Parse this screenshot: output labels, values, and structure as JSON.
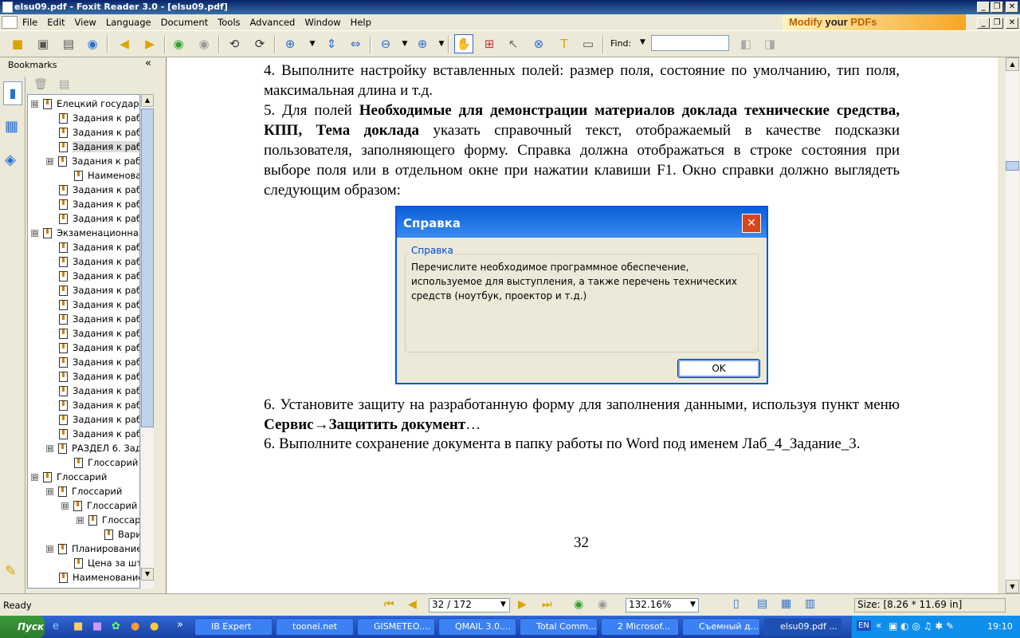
{
  "window": {
    "title": "elsu09.pdf - Foxit Reader 3.0 - [elsu09.pdf]",
    "minimize": "_",
    "restore": "❐",
    "close": "✕"
  },
  "menu": [
    "File",
    "Edit",
    "View",
    "Language",
    "Document",
    "Tools",
    "Advanced",
    "Window",
    "Help"
  ],
  "ad": {
    "part1": "Modify ",
    "part2": "your ",
    "part3": "PDFs"
  },
  "find": {
    "label": "Find:",
    "value": ""
  },
  "bookmarks": {
    "title": "Bookmarks",
    "collapse": "«",
    "items": [
      {
        "label": "Елецкий государс",
        "level": 0,
        "expander": "⊟"
      },
      {
        "label": "Задания к раб",
        "level": 1
      },
      {
        "label": "Задания к раб",
        "level": 1
      },
      {
        "label": "Задания к раб",
        "level": 1,
        "selected": true
      },
      {
        "label": "Задания к раб",
        "level": 1,
        "expander": "⊟"
      },
      {
        "label": "Наименова",
        "level": 2
      },
      {
        "label": "Задания к раб",
        "level": 1
      },
      {
        "label": "Задания к раб",
        "level": 1
      },
      {
        "label": "Задания к раб",
        "level": 1
      },
      {
        "label": "Экзаменационная",
        "level": 0,
        "expander": "⊟"
      },
      {
        "label": "Задания к раб",
        "level": 1
      },
      {
        "label": "Задания к раб",
        "level": 1
      },
      {
        "label": "Задания к раб",
        "level": 1
      },
      {
        "label": "Задания к раб",
        "level": 1
      },
      {
        "label": "Задания к раб",
        "level": 1
      },
      {
        "label": "Задания к раб",
        "level": 1
      },
      {
        "label": "Задания к раб",
        "level": 1
      },
      {
        "label": "Задания к раб",
        "level": 1
      },
      {
        "label": "Задания к раб",
        "level": 1
      },
      {
        "label": "Задания к раб",
        "level": 1
      },
      {
        "label": "Задания к раб",
        "level": 1
      },
      {
        "label": "Задания к раб",
        "level": 1
      },
      {
        "label": "Задания к раб",
        "level": 1
      },
      {
        "label": "Задания к раб",
        "level": 1
      },
      {
        "label": "РАЗДЕЛ 6. Зад",
        "level": 1,
        "expander": "⊟"
      },
      {
        "label": "Глоссарий",
        "level": 2
      },
      {
        "label": "Глоссарий",
        "level": 0,
        "expander": "⊟"
      },
      {
        "label": "Глоссарий",
        "level": 1,
        "expander": "⊟"
      },
      {
        "label": "Глоссарий",
        "level": 2,
        "expander": "⊟"
      },
      {
        "label": "Глоссар",
        "level": 3,
        "expander": "⊟"
      },
      {
        "label": "Вари",
        "level": 4
      },
      {
        "label": "Планирование",
        "level": 1,
        "expander": "⊟"
      },
      {
        "label": "Цена за шту",
        "level": 2
      },
      {
        "label": "Наименование",
        "level": 1
      }
    ]
  },
  "document": {
    "para4": "4. Выполните настройку вставленных полей: размер поля, состояние по умолчанию, тип поля, максимальная длина и т.д.",
    "para5_a": "5. Для полей ",
    "para5_bold": "Необходимые для демонстрации материалов доклада технические средства, КПП, Тема доклада",
    "para5_b": " указать справочный текст, отображаемый в качестве подсказки пользователя, заполняющего форму. Справка должна отображаться в строке состояния при выборе поля или в отдельном окне при нажатии клавиши F1. Окно справки должно выглядеть следующим образом:",
    "para6a_a": "6. Установите защиту на разработанную форму для заполнения данными, используя пункт меню ",
    "para6a_bold": "Сервис→Защитить документ",
    "para6a_b": "…",
    "para6b": "6. Выполните сохранение документа в папку работы по Word под именем Лаб_4_Задание_3.",
    "page_number": "32"
  },
  "dialog": {
    "title": "Справка",
    "close": "✕",
    "group_label": "Справка",
    "text": "Перечислите необходимое программное обеспечение, используемое для выступления, а также перечень технических средств (ноутбук, проектор и т.д.)",
    "ok": "OK"
  },
  "status": {
    "ready": "Ready",
    "page": "32 / 172",
    "zoom": "132.16%",
    "size": "Size: [8.26 * 11.69 in]"
  },
  "taskbar": {
    "start": "Пуск",
    "tasks": [
      "IB Expert",
      "toonel.net",
      "GISMETEO....",
      "QMAIL 3.0....",
      "Total Comm...",
      "2 Microsof...",
      "Съемный д...",
      "elsu09.pdf ..."
    ],
    "lang": "EN",
    "clock": "19:10",
    "chevron": "«",
    "quick_chevron": "»"
  }
}
